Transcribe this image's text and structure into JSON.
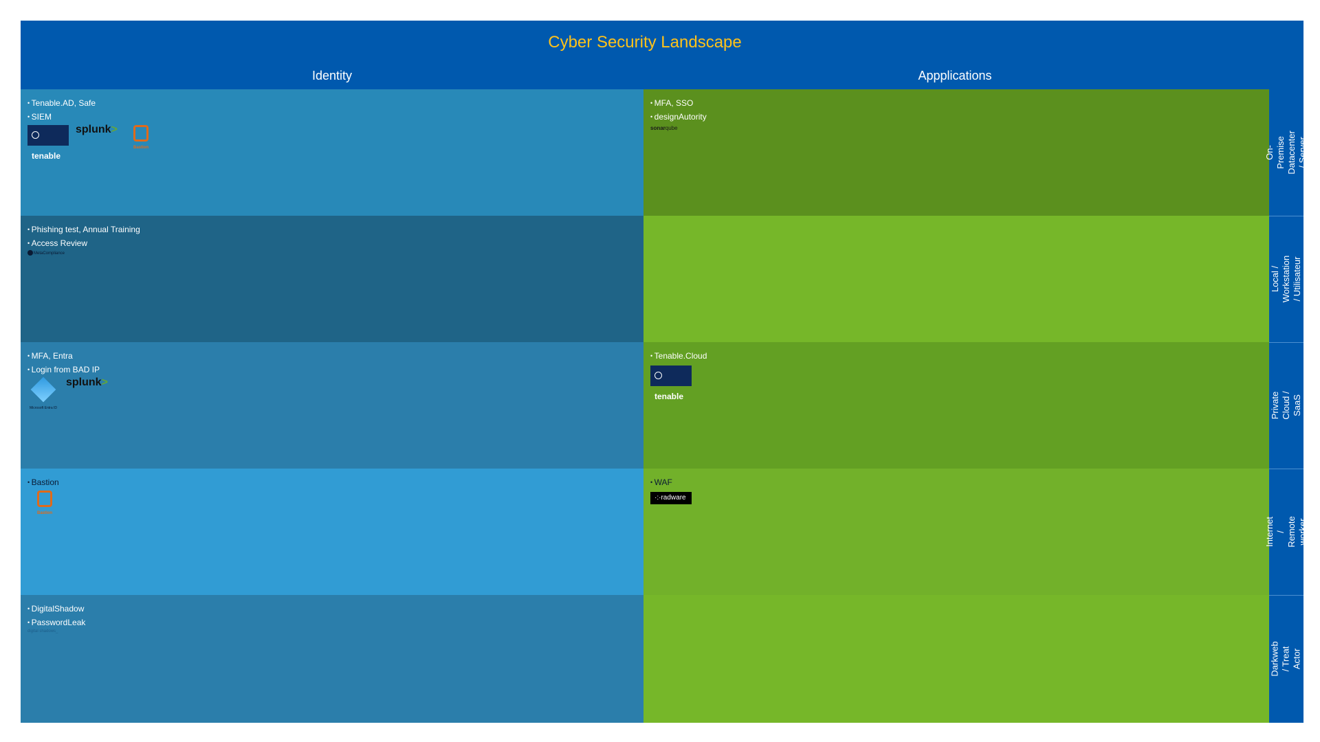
{
  "title": "Cyber Security Landscape",
  "columns": [
    {
      "label": "Identity"
    },
    {
      "label": "Appplications"
    }
  ],
  "rows": [
    {
      "label": "On-Premise Datacenter / Server"
    },
    {
      "label": "Local / Workstation / Utilisateur"
    },
    {
      "label": "Private Cloud / SaaS"
    },
    {
      "label": "Internet / Remote worker"
    },
    {
      "label": "Darkweb / Treat Actor"
    }
  ],
  "cells": {
    "identity_onprem": {
      "items": [
        "Tenable.AD, Safe",
        "SIEM"
      ]
    },
    "apps_onprem": {
      "items": [
        "MFA, SSO",
        "designAutority"
      ]
    },
    "identity_local": {
      "items": [
        "Phishing test, Annual Training",
        "Access Review"
      ]
    },
    "apps_local": {
      "items": []
    },
    "identity_cloud": {
      "items": [
        "MFA, Entra",
        "Login from BAD IP"
      ]
    },
    "apps_cloud": {
      "items": [
        "Tenable.Cloud"
      ]
    },
    "identity_internet": {
      "items": [
        "Bastion"
      ]
    },
    "apps_internet": {
      "items": [
        "WAF"
      ]
    },
    "identity_darkweb": {
      "items": [
        "DigitalShadow",
        "PasswordLeak"
      ]
    },
    "apps_darkweb": {
      "items": []
    }
  },
  "logos": {
    "tenable": "tenable",
    "splunk": "splunk",
    "splunk_mark": ">",
    "bastion": "Bastion",
    "metacompliance": "MetaCompliance",
    "sonar_a": "sonar",
    "sonar_b": "qube",
    "entra": "Microsoft Entra ID",
    "radware": "radware",
    "radware_mark": "·:·",
    "digitalshadows": "digital shadows_"
  },
  "colors": {
    "frame": "#0059ae",
    "title": "#ffc21a",
    "identity_rows": [
      "#2889b8",
      "#1f6487",
      "#2b7eab",
      "#319cd4",
      "#2b7eab"
    ],
    "apps_rows": [
      "#5b901e",
      "#76b729",
      "#63a023",
      "#72b12a",
      "#76b729"
    ]
  }
}
